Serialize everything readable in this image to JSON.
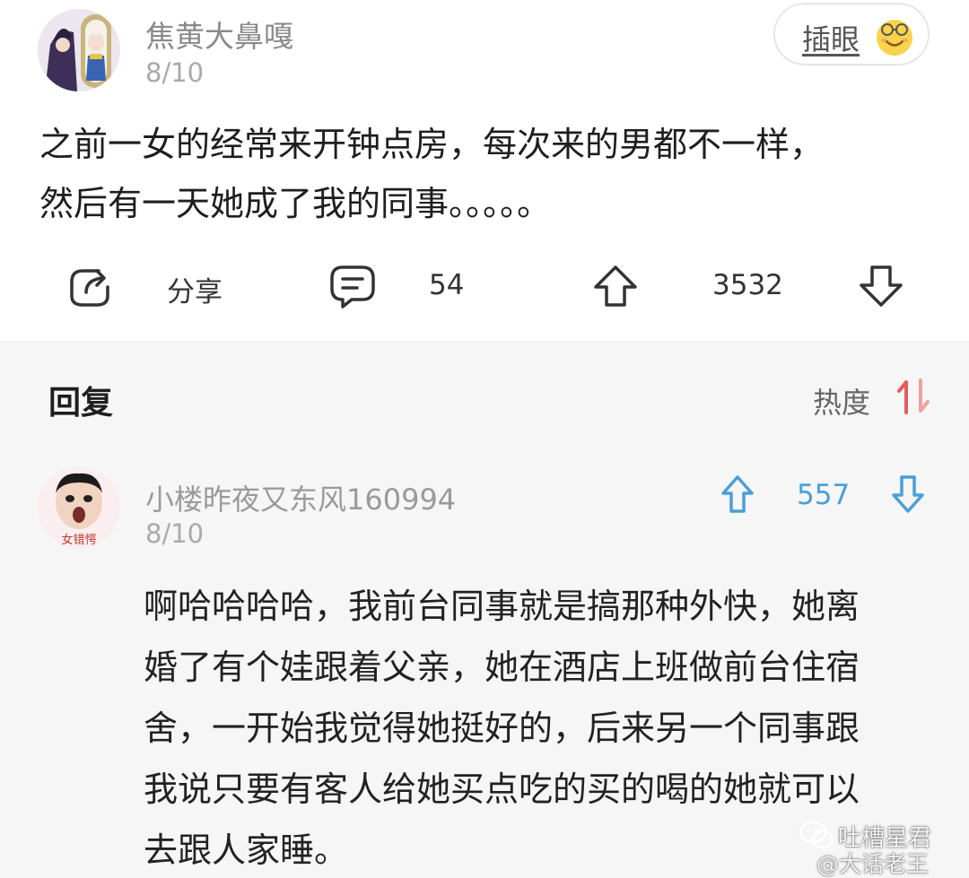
{
  "post": {
    "author": "焦黄大鼻嘎",
    "date": "8/10",
    "insert_label": "插眼",
    "text_lines": [
      "之前一女的经常来开钟点房，每次来的男都不一样，",
      "然后有一天她成了我的同事。。。。。"
    ],
    "share_label": "分享",
    "comment_count": "54",
    "vote_count": "3532",
    "icons": {
      "share": "share-icon",
      "comment": "comment-icon",
      "upvote": "upvote-icon",
      "downvote": "downvote-icon",
      "insert": "smiley-emoji-icon"
    }
  },
  "replies": {
    "title": "回复",
    "sort_label": "热度",
    "sort_icon": "sort-icon",
    "accent": "#e65c5c"
  },
  "comment": {
    "author": "小楼昨夜又东风160994",
    "date": "8/10",
    "vote_count": "557",
    "vote_color": "#4a9fd8",
    "avatar_caption": "女错愕",
    "text_lines": [
      "啊哈哈哈哈，我前台同事就是搞那种外快，她离",
      "婚了有个娃跟着父亲，她在酒店上班做前台住宿",
      "舍，一开始我觉得她挺好的，后来另一个同事跟",
      "我说只要有客人给她买点吃的买的喝的她就可以",
      "去跟人家睡。"
    ]
  },
  "watermark": {
    "line1": "吐槽星君",
    "line2": "@大话老王"
  }
}
